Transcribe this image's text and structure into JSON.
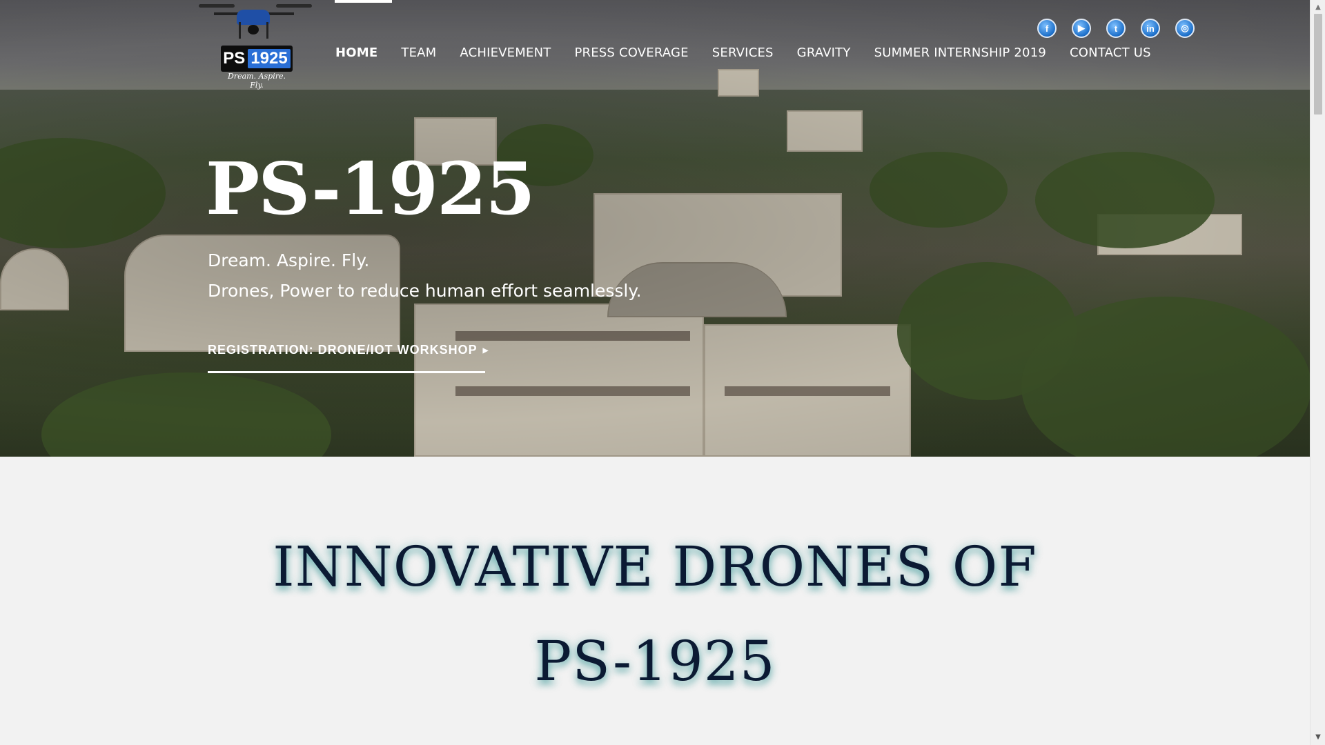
{
  "logo": {
    "text_left": "PS",
    "text_right": "1925",
    "tagline": "Dream. Aspire. Fly."
  },
  "nav": {
    "items": [
      {
        "label": "HOME",
        "active": true
      },
      {
        "label": "TEAM"
      },
      {
        "label": "ACHIEVEMENT"
      },
      {
        "label": "PRESS COVERAGE"
      },
      {
        "label": "SERVICES"
      },
      {
        "label": "GRAVITY"
      },
      {
        "label": "SUMMER INTERNSHIP 2019"
      },
      {
        "label": "CONTACT US"
      }
    ]
  },
  "social": [
    {
      "icon": "facebook-icon",
      "glyph": "f"
    },
    {
      "icon": "youtube-icon",
      "glyph": "▶"
    },
    {
      "icon": "twitter-icon",
      "glyph": "t"
    },
    {
      "icon": "linkedin-icon",
      "glyph": "in"
    },
    {
      "icon": "instagram-icon",
      "glyph": "◎"
    }
  ],
  "hero": {
    "title": "PS-1925",
    "line1": "Dream. Aspire. Fly.",
    "line2": "Drones, Power to reduce human effort seamlessly.",
    "cta": "REGISTRATION: DRONE/IOT WORKSHOP"
  },
  "section": {
    "title_line1": "INNOVATIVE DRONES OF",
    "title_line2": "PS-1925"
  },
  "colors": {
    "heading": "#0b1a33",
    "glow": "#3ca0a0",
    "social": "#1c6fc9"
  }
}
